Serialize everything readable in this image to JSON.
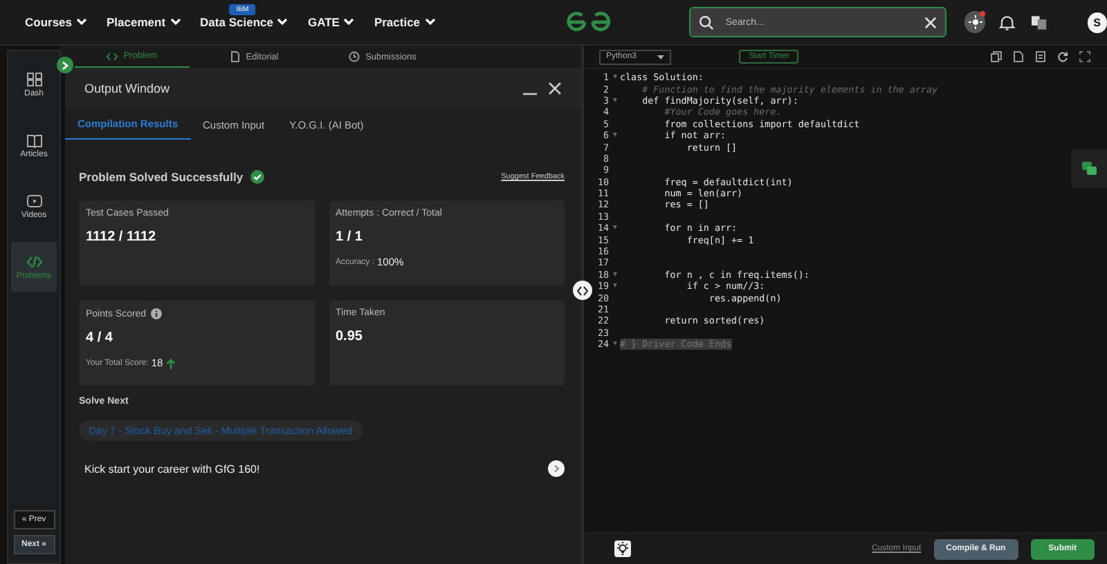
{
  "nav": {
    "items": [
      {
        "label": "Courses"
      },
      {
        "label": "Placement"
      },
      {
        "label": "Data Science",
        "badge": "IBM"
      },
      {
        "label": "GATE"
      },
      {
        "label": "Practice"
      }
    ],
    "search": {
      "placeholder": "Search..."
    },
    "avatar": "S",
    "notification": true
  },
  "sidebar": {
    "items": [
      {
        "label": "Dash",
        "selected": false
      },
      {
        "label": "Articles",
        "selected": false
      },
      {
        "label": "Videos",
        "selected": false
      },
      {
        "label": "Problems",
        "selected": true
      }
    ],
    "prev": "« Prev",
    "next": "Next »"
  },
  "problem_tabs": [
    {
      "label": "Problem",
      "selected": true
    },
    {
      "label": "Editorial",
      "selected": false
    },
    {
      "label": "Submissions",
      "selected": false
    }
  ],
  "output_window": {
    "title": "Output Window",
    "tabs": [
      {
        "label": "Compilation Results",
        "selected": true
      },
      {
        "label": "Custom Input",
        "selected": false
      },
      {
        "label": "Y.O.G.I. (AI Bot)",
        "selected": false
      }
    ],
    "status": "Problem Solved Successfully",
    "feedback": "Suggest Feedback",
    "cards": [
      {
        "title": "Test Cases Passed",
        "value": "1112 / 1112",
        "info": false
      },
      {
        "title": "Attempts : Correct / Total",
        "value": "1 / 1",
        "info": false,
        "note_label": "Accuracy :",
        "note_value": "100%"
      },
      {
        "title": "Points Scored",
        "value": "4 / 4",
        "info": true,
        "note_label": "Your Total Score:",
        "note_value": "18",
        "rising": true
      },
      {
        "title": "Time Taken",
        "value": "0.95",
        "info": false
      }
    ],
    "solve_next_title": "Solve Next",
    "next_problem": "Day 7 - Stock Buy and Sell - Multiple Transaction Allowed",
    "promo": "Kick start your career with GfG 160!"
  },
  "editor": {
    "language": "Python3",
    "timer": "Start Timer",
    "lines": [
      {
        "n": "1",
        "text": "class Solution:",
        "kind": "code",
        "fold": true
      },
      {
        "n": "2",
        "text": "    # Function to find the majority elements in the array",
        "kind": "comment",
        "fold": false
      },
      {
        "n": "3",
        "text": "    def findMajority(self, arr):",
        "kind": "code",
        "fold": true
      },
      {
        "n": "4",
        "text": "        #Your Code goes here.",
        "kind": "comment",
        "fold": false
      },
      {
        "n": "5",
        "text": "        from collections import defaultdict",
        "kind": "code",
        "fold": false
      },
      {
        "n": "6",
        "text": "        if not arr:",
        "kind": "code",
        "fold": true
      },
      {
        "n": "7",
        "text": "            return []",
        "kind": "code",
        "fold": false
      },
      {
        "n": "8",
        "fold": false
      },
      {
        "n": "9",
        "fold": false
      },
      {
        "n": "10",
        "text": "        freq = defaultdict(int)",
        "kind": "code",
        "fold": false
      },
      {
        "n": "11",
        "text": "        num = len(arr)",
        "kind": "code",
        "fold": false
      },
      {
        "n": "12",
        "text": "        res = []",
        "kind": "code",
        "fold": false
      },
      {
        "n": "13",
        "fold": false
      },
      {
        "n": "14",
        "text": "        for n in arr:",
        "kind": "code",
        "fold": true
      },
      {
        "n": "15",
        "text": "            freq[n] += 1",
        "kind": "code",
        "fold": false
      },
      {
        "n": "16",
        "fold": false
      },
      {
        "n": "17",
        "fold": false
      },
      {
        "n": "18",
        "text": "        for n , c in freq.items():",
        "kind": "code",
        "fold": true
      },
      {
        "n": "19",
        "text": "            if c > num//3:",
        "kind": "code",
        "fold": true
      },
      {
        "n": "20",
        "text": "                res.append(n)",
        "kind": "code",
        "fold": false
      },
      {
        "n": "21",
        "fold": false
      },
      {
        "n": "22",
        "text": "        return sorted(res)",
        "kind": "code",
        "fold": false
      },
      {
        "n": "23",
        "fold": false
      },
      {
        "n": "24",
        "text": "# } Driver Code Ends",
        "kind": "folded",
        "fold": true
      }
    ],
    "custom_input": "Custom Input",
    "compile": "Compile & Run",
    "submit": "Submit"
  }
}
